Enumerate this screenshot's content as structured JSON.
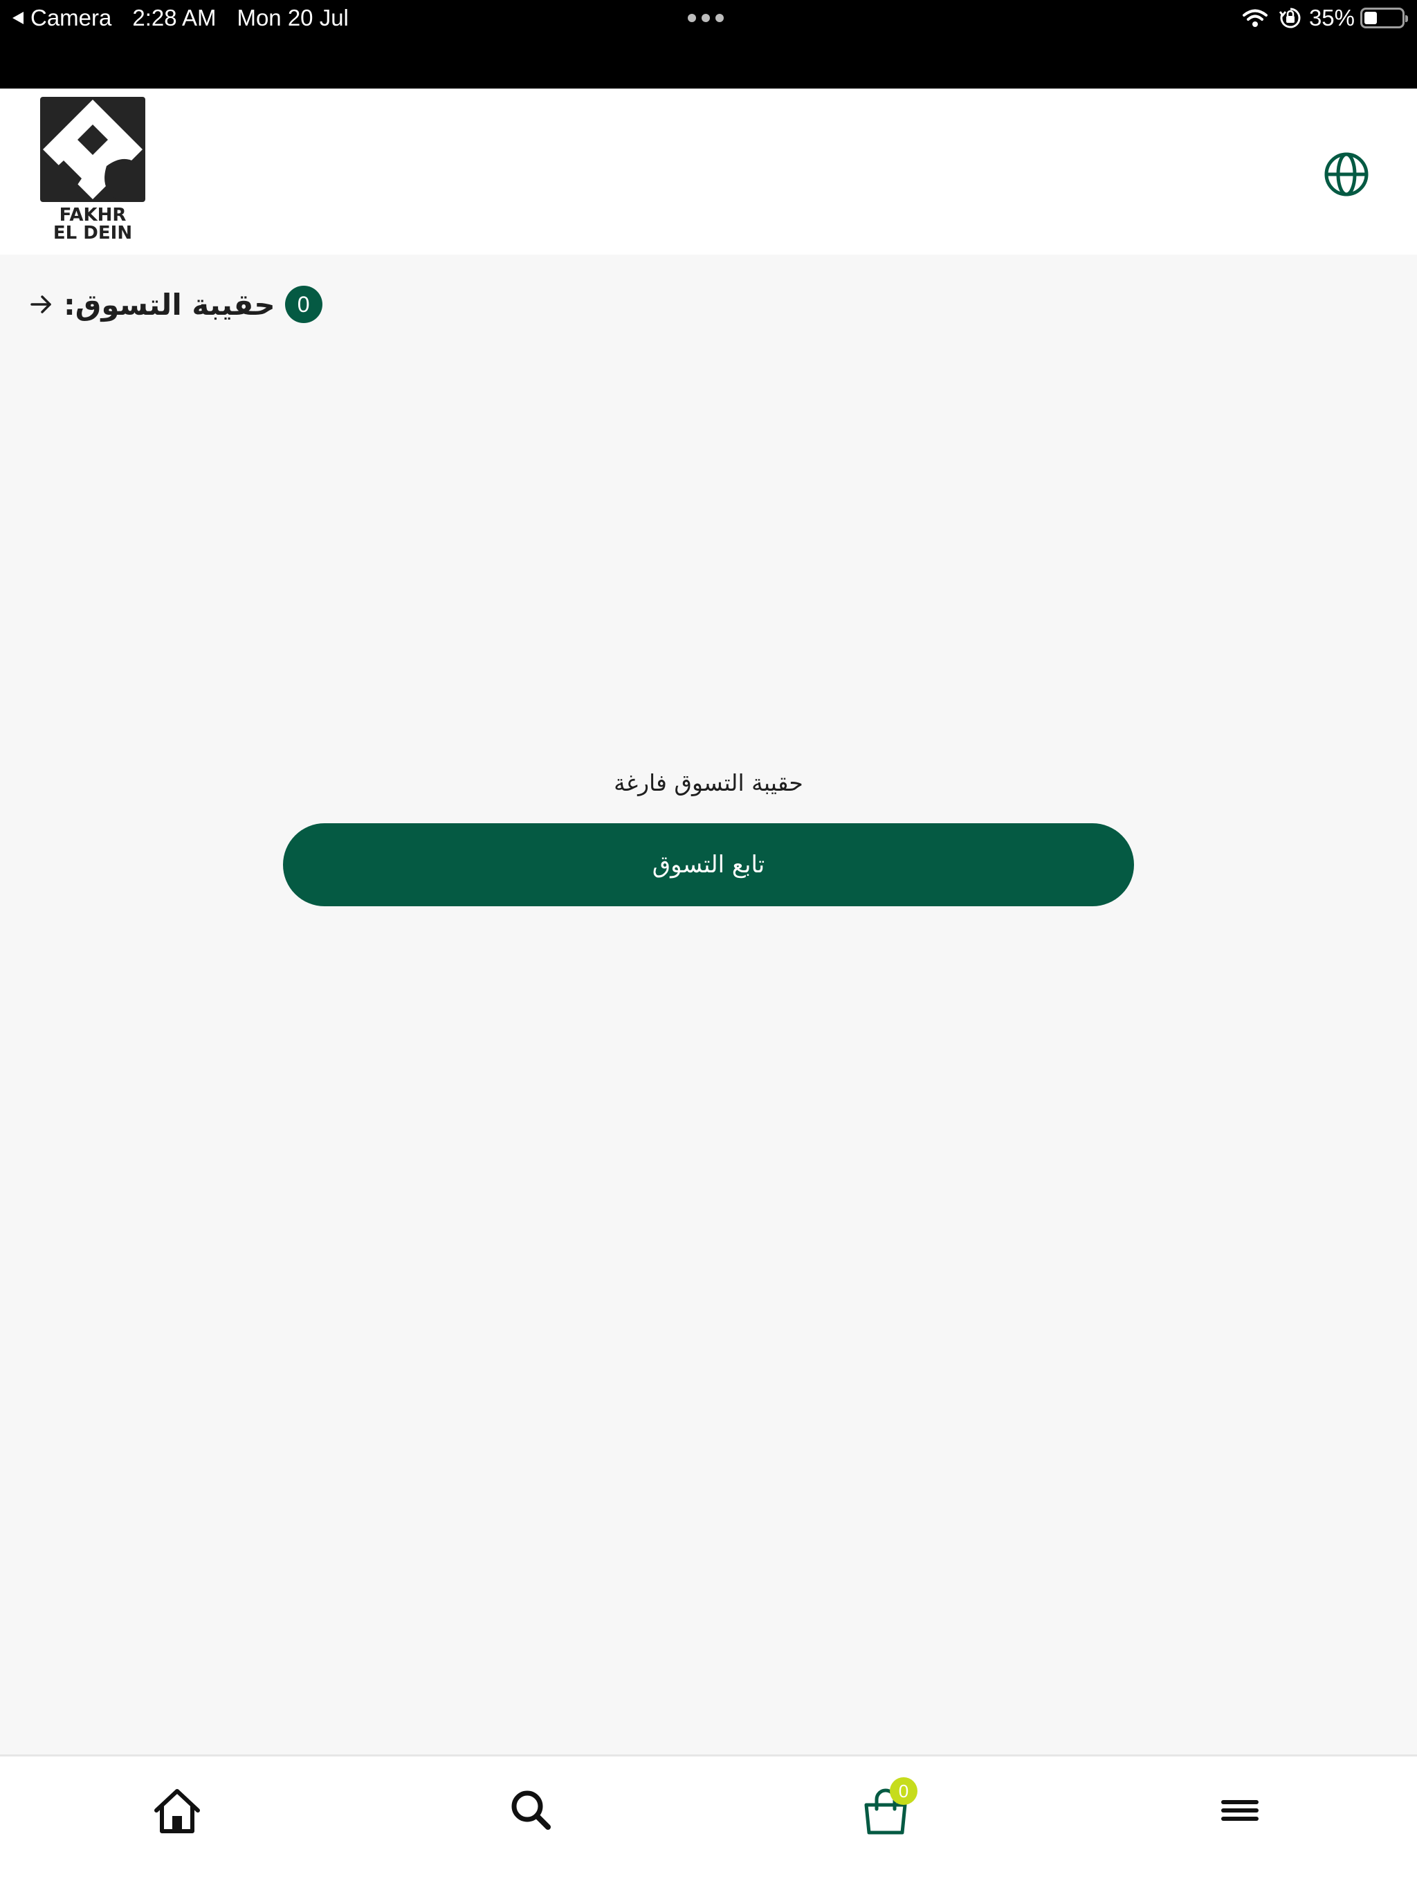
{
  "status_bar": {
    "back_app": "Camera",
    "time": "2:28 AM",
    "date": "Mon 20 Jul",
    "battery_percent": "35%",
    "battery_level": 0.35
  },
  "header": {
    "logo_line1": "FAKHR",
    "logo_line2": "EL DEIN",
    "language_icon": "globe-icon"
  },
  "cart": {
    "title": "حقيبة التسوق:",
    "item_count": "0",
    "empty_message": "حقيبة التسوق فارغة",
    "continue_label": "تابع التسوق"
  },
  "bottom_nav": {
    "items": [
      {
        "icon": "home-icon"
      },
      {
        "icon": "search-icon"
      },
      {
        "icon": "shopping-bag-icon",
        "badge": "0"
      },
      {
        "icon": "hamburger-menu-icon"
      }
    ]
  },
  "colors": {
    "brand_green": "#055a43",
    "badge_lime": "#c6dc1c",
    "background": "#f7f7f7"
  }
}
